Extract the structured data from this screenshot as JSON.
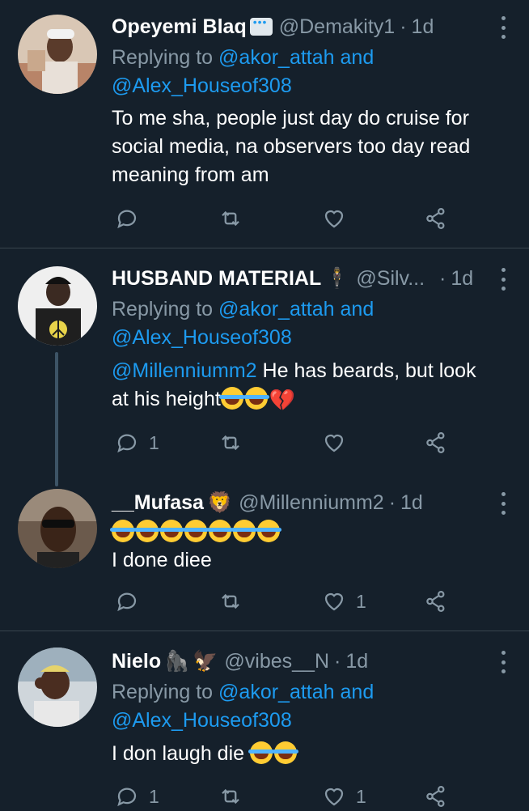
{
  "tweets": [
    {
      "name": "Opeyemi Blaq",
      "handle": "@Demakity1",
      "dot": "·",
      "time": "1d",
      "replying_prefix": "Replying to",
      "replying_user1": "@akor_attah",
      "replying_and": "and",
      "replying_user2": "@Alex_Houseof308",
      "text_line1": "To me sha, people just day do cruise for",
      "text_line2": "social media, na observers too day read",
      "text_line3": "meaning from am",
      "reply_count": "",
      "like_count": ""
    },
    {
      "name": "HUSBAND MATERIAL",
      "handle": "@Silv...",
      "dot": "·",
      "time": "1d",
      "replying_prefix": "Replying to",
      "replying_user1": "@akor_attah",
      "replying_and": "and",
      "replying_user2": "@Alex_Houseof308",
      "mention": "@Millenniumm2",
      "text_line1_rest": " He has beards, but look",
      "text_line2": "at his height",
      "reply_count": "1",
      "like_count": ""
    },
    {
      "name": "__Mufasa",
      "handle": "@Millenniumm2",
      "dot": "·",
      "time": "1d",
      "text_line2": "I done diee",
      "reply_count": "",
      "like_count": "1"
    },
    {
      "name": "Nielo",
      "handle": "@vibes__N",
      "dot": "·",
      "time": "1d",
      "replying_prefix": "Replying to",
      "replying_user1": "@akor_attah",
      "replying_and": "and",
      "replying_user2": "@Alex_Houseof308",
      "text_line1": "I don laugh die",
      "reply_count": "1",
      "like_count": "1"
    }
  ],
  "emoji": {
    "lion": "🦁",
    "gorilla": "🦍",
    "eagle": "🦅",
    "man_suit": "🕴",
    "broken_heart": "💔"
  },
  "colors": {
    "background": "#15202b",
    "divider": "#38444d",
    "secondary_text": "#8899a6",
    "link": "#1d9bf0"
  }
}
